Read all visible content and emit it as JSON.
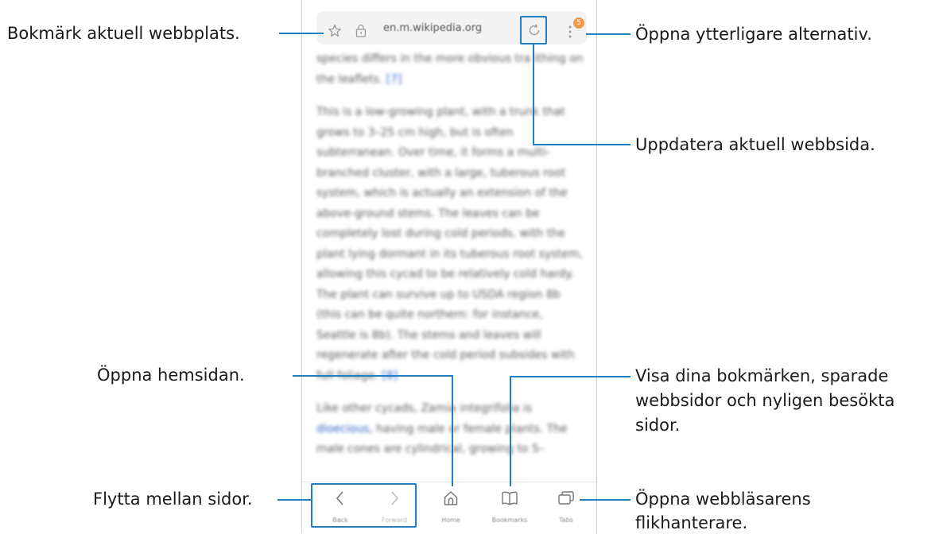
{
  "browser": {
    "url": "en.m.wikipedia.org",
    "menu_badge": "5"
  },
  "article": {
    "p1": "species differs in the more obvious tra ithing on the leaflets.",
    "p1_ref": "[7]",
    "p2": "This is a low-growing plant, with a trunk that grows to 3–25 cm high, but is often subterranean. Over time, it forms a multi-branched cluster, with a large, tuberous root system, which is actually an extension of the above-ground stems. The leaves can be completely lost during cold periods, with the plant lying dormant in its tuberous root system, allowing this cycad to be relatively cold hardy. The plant can survive up to USDA region 8b (this can be quite northern: for instance, Seattle is 8b). The stems and leaves will regenerate after the cold period subsides with full foliage.",
    "p2_ref": "[8]",
    "p3_pre": "Like other cycads, Zamia integrifolia is ",
    "p3_link": "dioecious",
    "p3_post": ", having male or female plants. The male cones are cylindrical, growing to 5–"
  },
  "bottom_nav": {
    "back": "Back",
    "forward": "Forward",
    "home": "Home",
    "bookmarks": "Bookmarks",
    "tabs": "Tabs"
  },
  "callouts": {
    "bookmark": "Bokmärk aktuell webbplats.",
    "more_options": "Öppna ytterligare alternativ.",
    "refresh": "Uppdatera aktuell webbsida.",
    "home": "Öppna hemsidan.",
    "bookmarks_line1": "Visa dina bokmärken, sparade",
    "bookmarks_line2": "webbsidor och nyligen besökta",
    "bookmarks_line3": "sidor.",
    "navigate": "Flytta mellan sidor.",
    "tabs_line1": "Öppna webbläsarens",
    "tabs_line2": "flikhanterare."
  },
  "colors": {
    "leader": "#1f7fc1",
    "badge": "#f2994a",
    "link": "#2b5fc5"
  },
  "icons": [
    "star-icon",
    "lock-icon",
    "refresh-icon",
    "more-vertical-icon",
    "chevron-left-icon",
    "chevron-right-icon",
    "home-icon",
    "book-icon",
    "tabs-icon"
  ]
}
